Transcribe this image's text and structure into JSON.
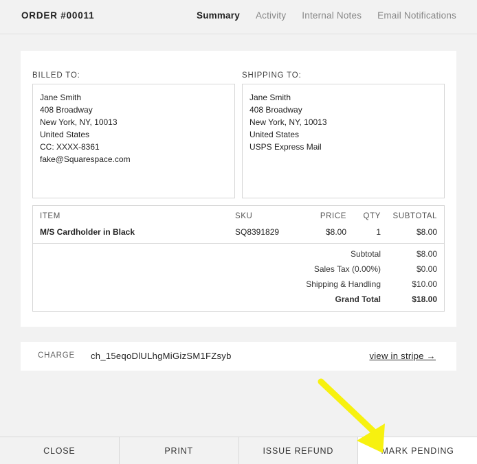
{
  "header": {
    "order_title": "ORDER #00011",
    "tabs": [
      {
        "label": "Summary",
        "active": true
      },
      {
        "label": "Activity",
        "active": false
      },
      {
        "label": "Internal Notes",
        "active": false
      },
      {
        "label": "Email Notifications",
        "active": false
      }
    ]
  },
  "billing": {
    "label": "BILLED TO:",
    "lines": [
      "Jane Smith",
      "408 Broadway",
      "New York, NY, 10013",
      "United States",
      "CC: XXXX-8361",
      "fake@Squarespace.com"
    ]
  },
  "shipping": {
    "label": "SHIPPING TO:",
    "lines": [
      "Jane Smith",
      "408 Broadway",
      "New York, NY, 10013",
      "United States",
      "USPS Express Mail"
    ]
  },
  "items": {
    "headers": {
      "item": "ITEM",
      "sku": "SKU",
      "price": "PRICE",
      "qty": "QTY",
      "subtotal": "SUBTOTAL"
    },
    "rows": [
      {
        "item": "M/S Cardholder in Black",
        "sku": "SQ8391829",
        "price": "$8.00",
        "qty": "1",
        "subtotal": "$8.00"
      }
    ],
    "totals": [
      {
        "label": "Subtotal",
        "value": "$8.00"
      },
      {
        "label": "Sales Tax (0.00%)",
        "value": "$0.00"
      },
      {
        "label": "Shipping & Handling",
        "value": "$10.00"
      },
      {
        "label": "Grand Total",
        "value": "$18.00"
      }
    ]
  },
  "charge": {
    "label": "CHARGE",
    "id": "ch_15eqoDlULhgMiGizSM1FZsyb",
    "link_label": "view in stripe →"
  },
  "footer": {
    "buttons": [
      "CLOSE",
      "PRINT",
      "ISSUE REFUND",
      "MARK PENDING"
    ]
  },
  "annotation": {
    "arrow_color": "#f7f10f",
    "points_to": "MARK PENDING"
  }
}
